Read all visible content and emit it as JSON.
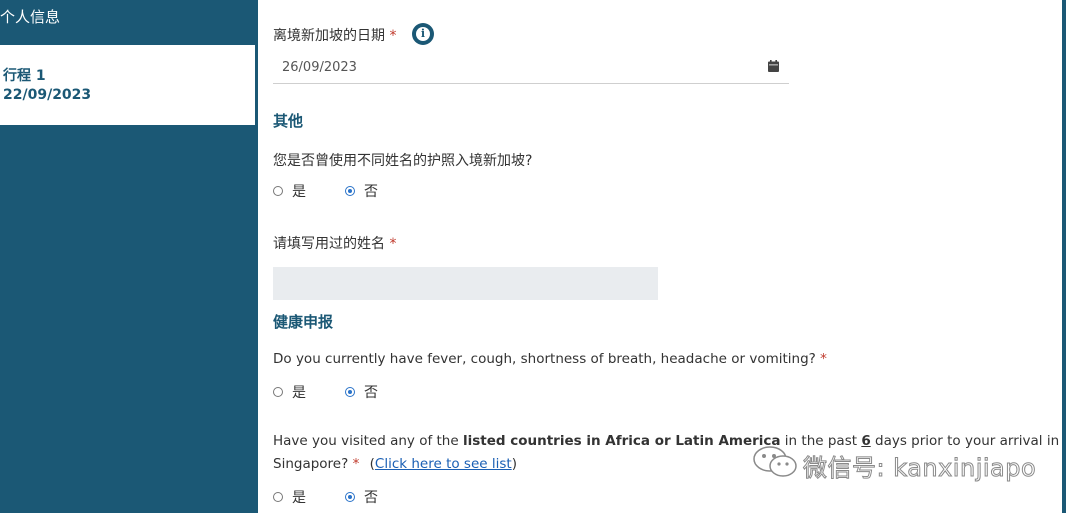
{
  "sidebar": {
    "heading": "个人信息",
    "trip": {
      "name": "行程 1",
      "date": "22/09/2023"
    }
  },
  "departure": {
    "label": "离境新加坡的日期",
    "required_mark": "*",
    "info_icon": "info-icon",
    "date_value": "26/09/2023",
    "calendar_icon": "calendar-icon"
  },
  "other": {
    "title": "其他",
    "question": "您是否曾使用不同姓名的护照入境新加坡?",
    "options": [
      {
        "label": "是",
        "checked": false
      },
      {
        "label": "否",
        "checked": true
      }
    ],
    "name_label": "请填写用过的姓名",
    "required_mark": "*",
    "name_value": ""
  },
  "health": {
    "title": "健康申报",
    "q1": {
      "text": "Do you currently have fever, cough, shortness of breath, headache or vomiting?",
      "required_mark": "*",
      "options": [
        {
          "label": "是",
          "checked": false
        },
        {
          "label": "否",
          "checked": true
        }
      ]
    },
    "q2": {
      "text_part1": "Have you visited any of the ",
      "text_bold": "listed countries in Africa or Latin America",
      "text_part2": " in the past ",
      "text_days": "6",
      "text_part3": " days prior to your arrival in",
      "line2_part1": "Singapore?",
      "required_mark": "*",
      "paren_open": "(",
      "link_text": "Click here to see list",
      "paren_close": ")",
      "options": [
        {
          "label": "是",
          "checked": false
        },
        {
          "label": "否",
          "checked": true
        }
      ]
    }
  },
  "watermark": {
    "text": "微信号: kanxinjiapo",
    "icon": "wechat-icon"
  },
  "colors": {
    "brand": "#1b5875",
    "required": "#c0392b",
    "radio": "#2a73c9",
    "link": "#1a5fb4"
  }
}
